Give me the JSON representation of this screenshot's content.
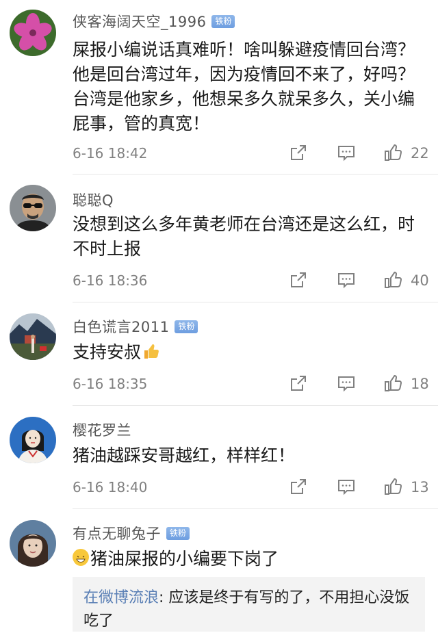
{
  "comments": [
    {
      "username": "侠客海阔天空_1996",
      "badge": "铁粉",
      "text": "屎报小编说话真难听！啥叫躲避疫情回台湾？他是回台湾过年，因为疫情回不来了，好吗？台湾是他家乡，他想呆多久就呆多久，关小编屁事，管的真宽！",
      "time": "6-16 18:42",
      "likes": "22",
      "avatar_colors": [
        "#3d6b2c",
        "#d54fa8"
      ]
    },
    {
      "username": "聪聪Q",
      "badge": "",
      "text": "没想到这么多年黄老师在台湾还是这么红，时不时上报",
      "time": "6-16 18:36",
      "likes": "40",
      "avatar_colors": [
        "#6b6b6b",
        "#c9a27e"
      ]
    },
    {
      "username": "白色谎言2011",
      "badge": "铁粉",
      "text": "支持安叔",
      "time": "6-16 18:35",
      "likes": "18",
      "avatar_colors": [
        "#2a3a50",
        "#b44a3a"
      ]
    },
    {
      "username": "樱花罗兰",
      "badge": "",
      "text": "猪油越踩安哥越红，样样红！",
      "time": "6-16 18:40",
      "likes": "13",
      "avatar_colors": [
        "#2c6fc2",
        "#f2e2d2"
      ]
    },
    {
      "username": "有点无聊兔子",
      "badge": "铁粉",
      "text": "猪油屎报的小编要下岗了",
      "avatar_colors": [
        "#5f7fa0",
        "#3a2a22"
      ],
      "reply": {
        "user": "在微博流浪",
        "text": ": 应该是终于有写的了，不用担心没饭吃了"
      }
    }
  ],
  "icons": {
    "forward": "share-square-icon",
    "comment": "comment-bubble-icon",
    "like": "thumbs-up-icon",
    "emoji": "grinning-face-emoji-icon",
    "thumb": "thumbs-up-emoji-icon"
  },
  "colors": {
    "badge": "#7aa6e4",
    "username": "#555555",
    "meta": "#808080",
    "reply_user": "#5a7fb5"
  }
}
